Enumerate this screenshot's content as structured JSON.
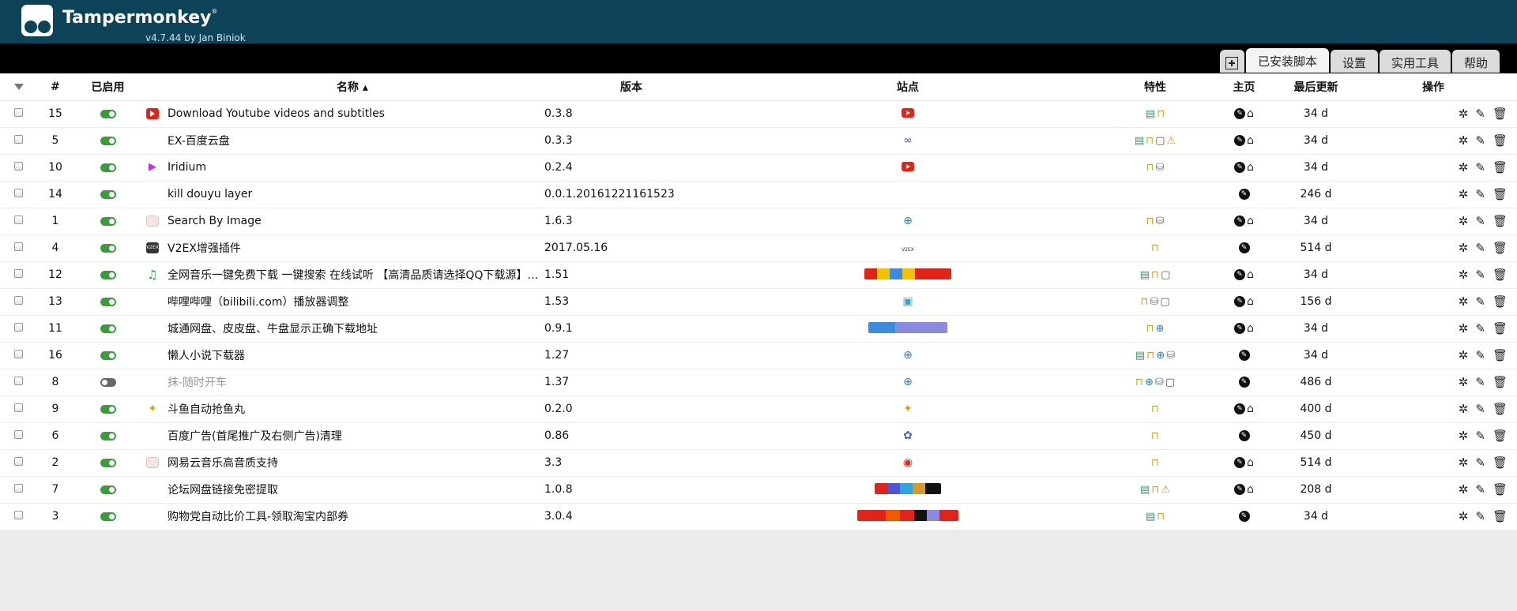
{
  "app": {
    "name": "Tampermonkey",
    "mark": "®",
    "subtitle": "v4.7.44 by Jan Biniok"
  },
  "tabs": [
    {
      "label": "已安装脚本",
      "active": true
    },
    {
      "label": "设置",
      "active": false
    },
    {
      "label": "实用工具",
      "active": false
    },
    {
      "label": "帮助",
      "active": false
    }
  ],
  "columns": {
    "num": "#",
    "enabled": "已启用",
    "name": "名称 ▴",
    "version": "版本",
    "sites": "站点",
    "features": "特性",
    "homepage": "主页",
    "updated": "最后更新",
    "actions": "操作"
  },
  "scripts": [
    {
      "num": "15",
      "enabled": true,
      "icon": "youtube",
      "name": "Download Youtube videos and subtitles",
      "version": "0.3.8",
      "site": "youtube",
      "features": [
        "doc",
        "lock"
      ],
      "home": 2,
      "updated": "34 d"
    },
    {
      "num": "5",
      "enabled": true,
      "icon": "",
      "name": "EX-百度云盘",
      "version": "0.3.3",
      "site": "baidu-pan",
      "features": [
        "doc",
        "lock",
        "win",
        "warn"
      ],
      "home": 2,
      "updated": "34 d"
    },
    {
      "num": "10",
      "enabled": true,
      "icon": "iridium",
      "name": "Iridium",
      "version": "0.2.4",
      "site": "youtube",
      "features": [
        "lock",
        "db"
      ],
      "home": 2,
      "updated": "34 d"
    },
    {
      "num": "14",
      "enabled": true,
      "icon": "",
      "name": "kill douyu layer",
      "version": "0.0.1.20161221161523",
      "site": "",
      "features": [],
      "home": 1,
      "updated": "246 d"
    },
    {
      "num": "1",
      "enabled": true,
      "icon": "image",
      "name": "Search By Image",
      "version": "1.6.3",
      "site": "globe",
      "features": [
        "lock",
        "db"
      ],
      "home": 2,
      "updated": "34 d"
    },
    {
      "num": "4",
      "enabled": true,
      "icon": "v2ex",
      "name": "V2EX增强插件",
      "version": "2017.05.16",
      "site": "v2ex",
      "features": [
        "lock"
      ],
      "home": 1,
      "updated": "514 d"
    },
    {
      "num": "12",
      "enabled": true,
      "icon": "music",
      "name": "全网音乐一键免费下载 一键搜索 在线试听 【高清品质请选择QQ下载源】2...",
      "version": "1.51",
      "site": "music-multi",
      "features": [
        "doc",
        "lock",
        "win"
      ],
      "home": 2,
      "updated": "34 d"
    },
    {
      "num": "13",
      "enabled": true,
      "icon": "",
      "name": "哔哩哔哩（bilibili.com）播放器调整",
      "version": "1.53",
      "site": "bilibili",
      "features": [
        "lock",
        "db",
        "win"
      ],
      "home": 2,
      "updated": "156 d"
    },
    {
      "num": "11",
      "enabled": true,
      "icon": "",
      "name": "城通网盘、皮皮盘、牛盘显示正确下载地址",
      "version": "0.9.1",
      "site": "ctdisk-multi",
      "features": [
        "lock",
        "web"
      ],
      "home": 2,
      "updated": "34 d"
    },
    {
      "num": "16",
      "enabled": true,
      "icon": "",
      "name": "懒人小说下载器",
      "version": "1.27",
      "site": "globe",
      "features": [
        "doc",
        "lock",
        "web",
        "db"
      ],
      "home": 1,
      "updated": "34 d"
    },
    {
      "num": "8",
      "enabled": false,
      "icon": "",
      "name": "抹-随时开车",
      "version": "1.37",
      "site": "globe",
      "features": [
        "lock",
        "web",
        "db",
        "win"
      ],
      "home": 1,
      "updated": "486 d"
    },
    {
      "num": "9",
      "enabled": true,
      "icon": "douyu",
      "name": "斗鱼自动抢鱼丸",
      "version": "0.2.0",
      "site": "douyu",
      "features": [
        "lock"
      ],
      "home": 2,
      "updated": "400 d"
    },
    {
      "num": "6",
      "enabled": true,
      "icon": "",
      "name": "百度广告(首尾推广及右侧广告)清理",
      "version": "0.86",
      "site": "baidu",
      "features": [
        "lock"
      ],
      "home": 1,
      "updated": "450 d"
    },
    {
      "num": "2",
      "enabled": true,
      "icon": "image",
      "name": "网易云音乐高音质支持",
      "version": "3.3",
      "site": "netease",
      "features": [
        "lock"
      ],
      "home": 2,
      "updated": "514 d"
    },
    {
      "num": "7",
      "enabled": true,
      "icon": "",
      "name": "论坛网盘链接免密提取",
      "version": "1.0.8",
      "site": "pan-multi",
      "features": [
        "doc",
        "lock",
        "warn"
      ],
      "home": 2,
      "updated": "208 d"
    },
    {
      "num": "3",
      "enabled": true,
      "icon": "",
      "name": "购物党自动比价工具-领取淘宝内部券",
      "version": "3.0.4",
      "site": "shop-multi",
      "features": [
        "doc",
        "lock"
      ],
      "home": 1,
      "updated": "34 d"
    }
  ]
}
